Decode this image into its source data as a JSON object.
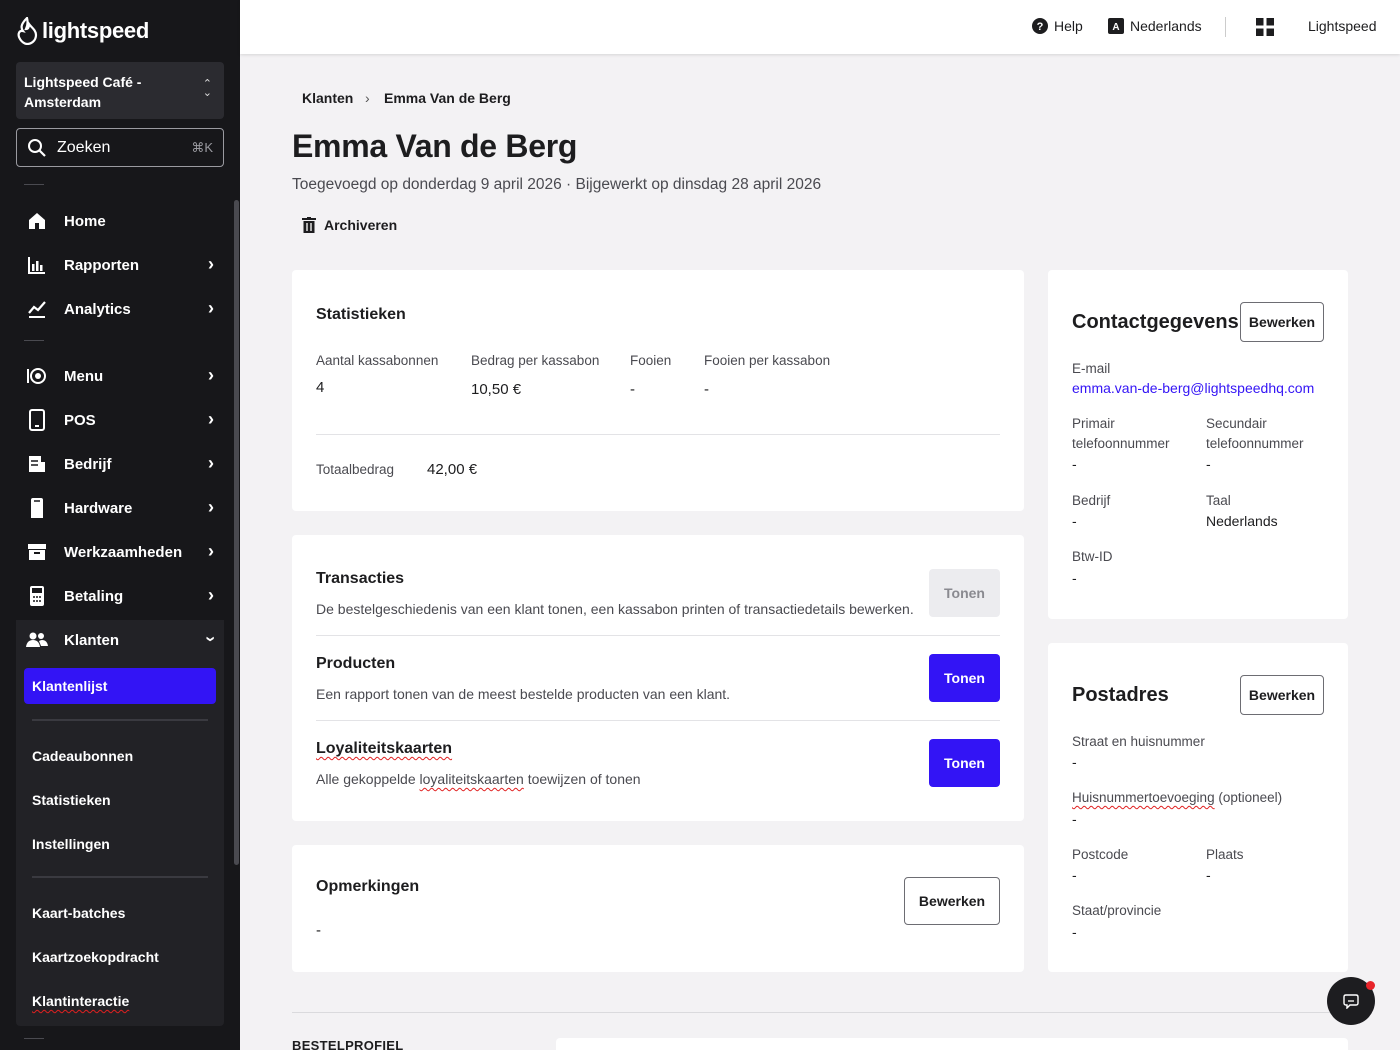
{
  "sidebar": {
    "brand": "lightspeed",
    "venue": "Lightspeed Café - Amsterdam",
    "search_label": "Zoeken",
    "search_shortcut": "⌘K",
    "nav": [
      {
        "label": "Home",
        "icon": "home-icon"
      },
      {
        "label": "Rapporten",
        "icon": "bar-chart-icon"
      },
      {
        "label": "Analytics",
        "icon": "line-chart-icon"
      },
      {
        "label": "Menu",
        "icon": "menu-icon"
      },
      {
        "label": "POS",
        "icon": "tablet-icon"
      },
      {
        "label": "Bedrijf",
        "icon": "receipt-icon"
      },
      {
        "label": "Hardware",
        "icon": "printer-icon"
      },
      {
        "label": "Werkzaamheden",
        "icon": "archive-box-icon"
      },
      {
        "label": "Betaling",
        "icon": "payment-terminal-icon"
      },
      {
        "label": "Klanten",
        "icon": "users-icon"
      }
    ],
    "sub": [
      "Klantenlijst",
      "Cadeaubonnen",
      "Statistieken",
      "Instellingen",
      "Kaart-batches",
      "Kaartzoekopdracht",
      "Klantinteractie"
    ]
  },
  "topbar": {
    "help": "Help",
    "language": "Nederlands",
    "account": "Lightspeed"
  },
  "breadcrumb": {
    "parent": "Klanten",
    "current": "Emma Van de Berg"
  },
  "page": {
    "title": "Emma Van de Berg",
    "subtitle": "Toegevoegd op donderdag 9 april 2026 · Bijgewerkt op dinsdag 28 april 2026",
    "archive": "Archiveren"
  },
  "stats": {
    "title": "Statistieken",
    "items": [
      {
        "label": "Aantal kassabonnen",
        "value": "4"
      },
      {
        "label": "Bedrag per kassabon",
        "value": "10,50 €"
      },
      {
        "label": "Fooien",
        "value": "-"
      },
      {
        "label": "Fooien per kassabon",
        "value": "-"
      }
    ],
    "total_label": "Totaalbedrag",
    "total_value": "42,00 €"
  },
  "sections": [
    {
      "title": "Transacties",
      "desc": "De bestelgeschiedenis van een klant tonen, een kassabon printen of transactiedetails bewerken.",
      "button": "Tonen",
      "enabled": false
    },
    {
      "title": "Producten",
      "desc": "Een rapport tonen van de meest bestelde producten van een klant.",
      "button": "Tonen",
      "enabled": true
    },
    {
      "title": "Loyaliteitskaarten",
      "desc_pre": "Alle gekoppelde ",
      "desc_mid": "loyaliteitskaarten",
      "desc_post": " toewijzen of tonen",
      "button": "Tonen",
      "enabled": true
    }
  ],
  "notes": {
    "title": "Opmerkingen",
    "value": "-",
    "button": "Bewerken"
  },
  "contact": {
    "title": "Contactgegevens",
    "button": "Bewerken",
    "email_label": "E-mail",
    "email": "emma.van-de-berg@lightspeedhq.com",
    "primary_phone_label_1": "Primair",
    "primary_phone_label_2": "telefoonnummer",
    "primary_phone": "-",
    "secondary_phone_label_1": "Secundair",
    "secondary_phone_label_2": "telefoonnummer",
    "secondary_phone": "-",
    "company_label": "Bedrijf",
    "company": "-",
    "language_label": "Taal",
    "language": "Nederlands",
    "vat_label": "Btw-ID",
    "vat": "-"
  },
  "address": {
    "title": "Postadres",
    "button": "Bewerken",
    "street_label": "Straat en huisnummer",
    "street": "-",
    "addition_label": "Huisnummertoevoeging",
    "addition_suffix": " (optioneel)",
    "addition": "-",
    "postcode_label": "Postcode",
    "postcode": "-",
    "city_label": "Plaats",
    "city": "-",
    "state_label": "Staat/provincie",
    "state": "-"
  },
  "bottom_section_label": "BESTELPROFIEL",
  "colors": {
    "accent": "#3314f5",
    "sidebar": "#17171a",
    "background": "#f3f2f4"
  }
}
